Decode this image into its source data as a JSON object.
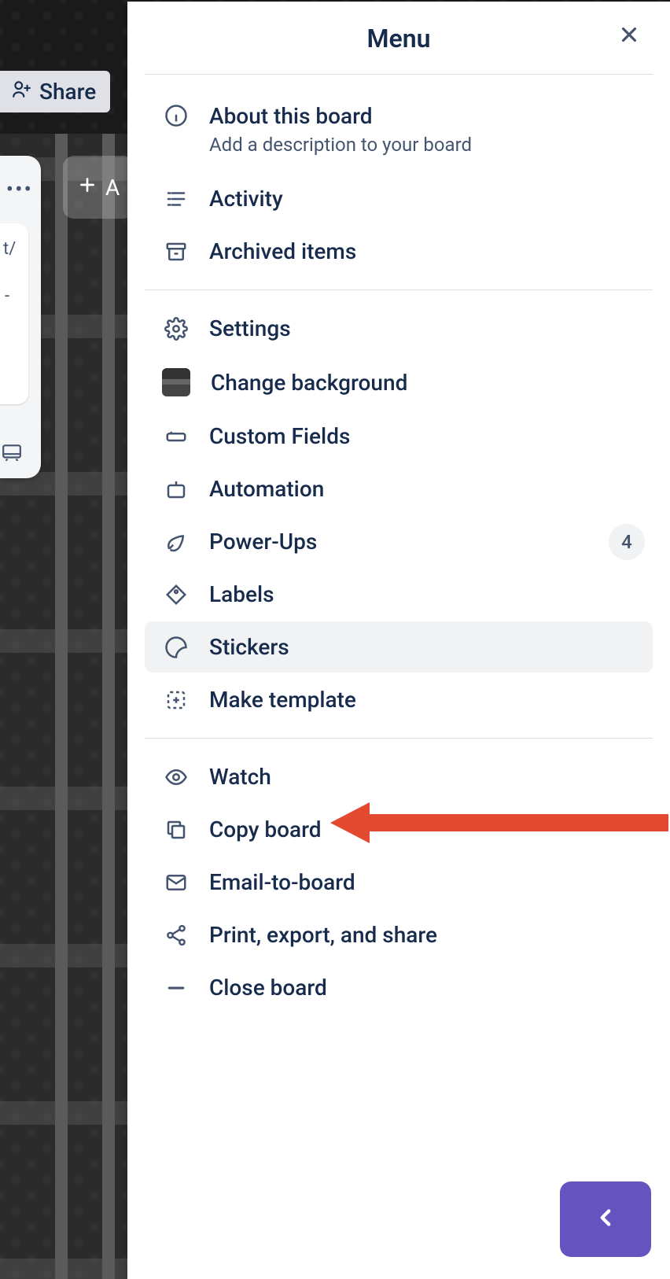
{
  "header": {
    "title": "Menu"
  },
  "board_actions": {
    "share": "Share",
    "add_partial": "A",
    "card_text": "t/"
  },
  "menu": {
    "about": {
      "label": "About this board",
      "sub": "Add a description to your board"
    },
    "activity": "Activity",
    "archived": "Archived items",
    "settings": "Settings",
    "change_bg": "Change background",
    "custom_fields": "Custom Fields",
    "automation": "Automation",
    "powerups": {
      "label": "Power-Ups",
      "count": "4"
    },
    "labels": "Labels",
    "stickers": "Stickers",
    "make_template": "Make template",
    "watch": "Watch",
    "copy_board": "Copy board",
    "email_to_board": "Email-to-board",
    "print_export": "Print, export, and share",
    "close_board": "Close board"
  }
}
